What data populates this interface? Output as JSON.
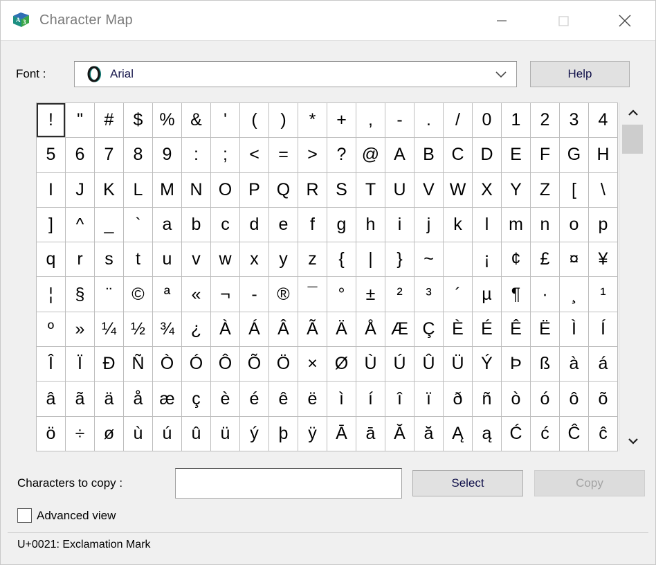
{
  "window": {
    "title": "Character Map",
    "icon": "charmap-icon",
    "minimize_label": "minimize-icon",
    "maximize_label": "maximize-icon",
    "close_label": "close-icon"
  },
  "font_row": {
    "label": "Font :",
    "selected_font": "Arial",
    "font_type_icon": "truetype-o-icon",
    "dropdown_icon": "chevron-down-icon",
    "help_label": "Help"
  },
  "grid": {
    "selected_index": 0,
    "columns": 20,
    "rows": [
      [
        "!",
        "\"",
        "#",
        "$",
        "%",
        "&",
        "'",
        "(",
        ")",
        "*",
        "+",
        ",",
        "-",
        ".",
        "/",
        "0",
        "1",
        "2",
        "3",
        "4"
      ],
      [
        "5",
        "6",
        "7",
        "8",
        "9",
        ":",
        ";",
        "<",
        "=",
        ">",
        "?",
        "@",
        "A",
        "B",
        "C",
        "D",
        "E",
        "F",
        "G",
        "H"
      ],
      [
        "I",
        "J",
        "K",
        "L",
        "M",
        "N",
        "O",
        "P",
        "Q",
        "R",
        "S",
        "T",
        "U",
        "V",
        "W",
        "X",
        "Y",
        "Z",
        "[",
        "\\"
      ],
      [
        "]",
        "^",
        "_",
        "`",
        "a",
        "b",
        "c",
        "d",
        "e",
        "f",
        "g",
        "h",
        "i",
        "j",
        "k",
        "l",
        "m",
        "n",
        "o",
        "p"
      ],
      [
        "q",
        "r",
        "s",
        "t",
        "u",
        "v",
        "w",
        "x",
        "y",
        "z",
        "{",
        "|",
        "}",
        "~",
        "",
        "¡",
        "¢",
        "£",
        "¤",
        "¥"
      ],
      [
        "¦",
        "§",
        "¨",
        "©",
        "ª",
        "«",
        "¬",
        "­-",
        "®",
        "¯",
        "°",
        "±",
        "²",
        "³",
        "´",
        "µ",
        "¶",
        "·",
        "¸",
        "¹"
      ],
      [
        "º",
        "»",
        "¼",
        "½",
        "¾",
        "¿",
        "À",
        "Á",
        "Â",
        "Ã",
        "Ä",
        "Å",
        "Æ",
        "Ç",
        "È",
        "É",
        "Ê",
        "Ë",
        "Ì",
        "Í"
      ],
      [
        "Î",
        "Ï",
        "Ð",
        "Ñ",
        "Ò",
        "Ó",
        "Ô",
        "Õ",
        "Ö",
        "×",
        "Ø",
        "Ù",
        "Ú",
        "Û",
        "Ü",
        "Ý",
        "Þ",
        "ß",
        "à",
        "á"
      ],
      [
        "â",
        "ã",
        "ä",
        "å",
        "æ",
        "ç",
        "è",
        "é",
        "ê",
        "ë",
        "ì",
        "í",
        "î",
        "ï",
        "ð",
        "ñ",
        "ò",
        "ó",
        "ô",
        "õ"
      ],
      [
        "ö",
        "÷",
        "ø",
        "ù",
        "ú",
        "û",
        "ü",
        "ý",
        "þ",
        "ÿ",
        "Ā",
        "ā",
        "Ă",
        "ă",
        "Ą",
        "ą",
        "Ć",
        "ć",
        "Ĉ",
        "ĉ"
      ]
    ]
  },
  "scrollbar": {
    "up_icon": "chevron-up-icon",
    "down_icon": "chevron-down-icon",
    "thumb": "scroll-thumb"
  },
  "copy_row": {
    "label": "Characters to copy :",
    "input_value": "",
    "input_placeholder": "",
    "select_label": "Select",
    "copy_label": "Copy",
    "copy_disabled": true
  },
  "advanced": {
    "label": "Advanced view",
    "checked": false
  },
  "status": {
    "text": "U+0021: Exclamation Mark"
  },
  "colors": {
    "window_bg": "#f0f0f0",
    "titlebar_bg": "#ffffff",
    "title_fg": "#7a7a7a",
    "button_face": "#e1e1e1",
    "button_border": "#adadad",
    "disabled_fg": "#a3a3a3",
    "grid_line": "#bdbdbd",
    "selection_border": "#2b2b2b",
    "scroll_thumb": "#cdcdcd"
  }
}
